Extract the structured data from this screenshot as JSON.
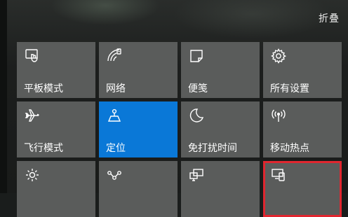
{
  "header": {
    "collapse_label": "折叠"
  },
  "colors": {
    "tile": "#5a5c5b",
    "active": "#0a78d7",
    "highlight": "#e0262f"
  },
  "tiles": [
    {
      "label": "平板模式",
      "icon": "tablet-mode-icon"
    },
    {
      "label": "网络",
      "icon": "network-icon"
    },
    {
      "label": "便笺",
      "icon": "note-icon"
    },
    {
      "label": "所有设置",
      "icon": "gear-icon"
    },
    {
      "label": "飞行模式",
      "icon": "airplane-icon"
    },
    {
      "label": "定位",
      "icon": "location-icon",
      "active": true
    },
    {
      "label": "免打扰时间",
      "icon": "moon-icon"
    },
    {
      "label": "移动热点",
      "icon": "hotspot-icon"
    },
    {
      "label": "",
      "icon": "brightness-icon"
    },
    {
      "label": "",
      "icon": "vpn-icon"
    },
    {
      "label": "",
      "icon": "project-icon"
    },
    {
      "label": "",
      "icon": "connect-icon",
      "highlighted": true
    }
  ]
}
